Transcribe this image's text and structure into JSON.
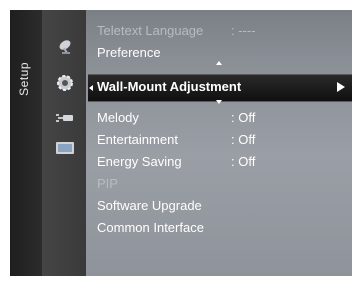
{
  "side_label": "Setup",
  "icons": [
    "satellite-dish-icon",
    "gear-icon",
    "input-plug-icon",
    "picture-monitor-icon"
  ],
  "menu": {
    "items": [
      {
        "label": "Teletext Language",
        "value": ": ----"
      },
      {
        "label": "Preference",
        "value": ""
      },
      {
        "label": "Wall-Mount Adjustment",
        "value": ""
      },
      {
        "label": "Melody",
        "value": ": Off"
      },
      {
        "label": "Entertainment",
        "value": ": Off"
      },
      {
        "label": "Energy Saving",
        "value": ": Off"
      },
      {
        "label": "PIP",
        "value": ""
      },
      {
        "label": "Software Upgrade",
        "value": ""
      },
      {
        "label": "Common Interface",
        "value": ""
      }
    ]
  }
}
